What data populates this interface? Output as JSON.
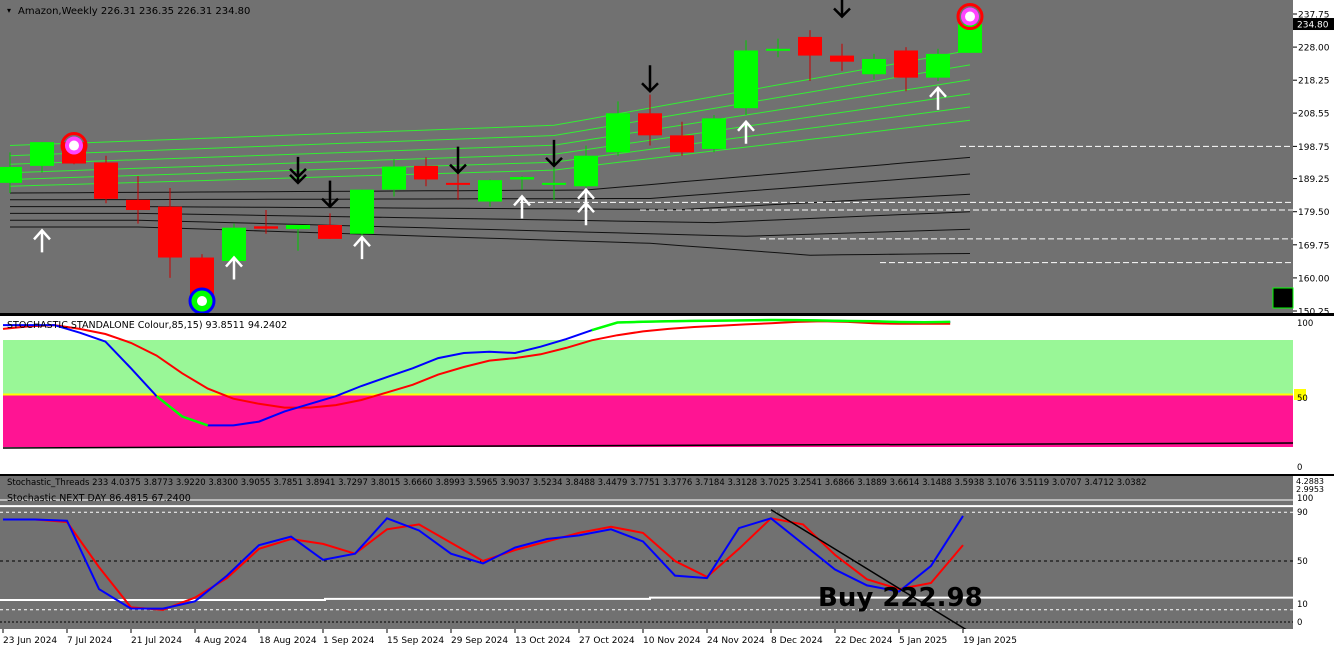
{
  "header": {
    "symbol_line": "Amazon,Weekly  226.31 236.35 226.31 234.80"
  },
  "main_panel": {
    "price_axis": [
      "237.75",
      "228.00",
      "218.25",
      "208.55",
      "198.75",
      "189.25",
      "179.50",
      "169.75",
      "160.00",
      "150.25"
    ],
    "current_price": "234.80",
    "colors": {
      "bull": "#00ff00",
      "bear": "#ff0000",
      "background": "#717171",
      "band_green": "#33ee33",
      "band_black": "#000000"
    }
  },
  "indicator1": {
    "title": "STOCHASTIC STANDALONE Colour,85,15) 93.8511 94.2402",
    "axis": [
      "100",
      "50",
      "0"
    ],
    "zone_colors": {
      "top": "#99f797",
      "bottom": "#ff1493",
      "fifty_marker": "#ffff00"
    }
  },
  "indicator2": {
    "threads_line": "Stochastic_Threads 233 4.0375 3.8773 3.9220 3.8300 3.9055 3.7851 3.8941 3.7297 3.8015 3.6660 3.8993 3.5965 3.9037 3.5234 3.8488 3.4479 3.7751 3.3776 3.7184 3.3128 3.7025 3.2541 3.6866 3.1889 3.6614 3.1488 3.5938 3.1076 3.5119 3.0707 3.4712 3.0382",
    "title": "Stochastic NEXT DAY 86.4815 67.2400",
    "axis_left_top": "4.2883",
    "axis_left_bottom": "2.9953",
    "axis": [
      "100",
      "90",
      "50",
      "10",
      "0"
    ],
    "signal_text": "Buy 222.98"
  },
  "x_axis": {
    "labels": [
      "23 Jun 2024",
      "7 Jul 2024",
      "21 Jul 2024",
      "4 Aug 2024",
      "18 Aug 2024",
      "1 Sep 2024",
      "15 Sep 2024",
      "29 Sep 2024",
      "13 Oct 2024",
      "27 Oct 2024",
      "10 Nov 2024",
      "24 Nov 2024",
      "8 Dec 2024",
      "22 Dec 2024",
      "5 Jan 2025",
      "19 Jan 2025"
    ]
  },
  "chart_data": {
    "type": "candlestick",
    "symbol": "Amazon",
    "timeframe": "Weekly",
    "ohlc": [
      {
        "o": 188.0,
        "h": 197.0,
        "l": 185.0,
        "c": 192.7
      },
      {
        "o": 193.0,
        "h": 200.0,
        "l": 191.0,
        "c": 200.0
      },
      {
        "o": 200.0,
        "h": 201.0,
        "l": 193.5,
        "c": 193.7
      },
      {
        "o": 194.0,
        "h": 196.0,
        "l": 182.0,
        "c": 183.3
      },
      {
        "o": 183.0,
        "h": 190.0,
        "l": 176.0,
        "c": 180.0
      },
      {
        "o": 181.0,
        "h": 186.5,
        "l": 160.0,
        "c": 166.0
      },
      {
        "o": 166.0,
        "h": 167.0,
        "l": 151.6,
        "c": 152.0
      },
      {
        "o": 165.0,
        "h": 176.0,
        "l": 160.0,
        "c": 174.8
      },
      {
        "o": 175.2,
        "h": 180.0,
        "l": 173.0,
        "c": 174.5
      },
      {
        "o": 174.4,
        "h": 175.5,
        "l": 168.0,
        "c": 175.6
      },
      {
        "o": 175.6,
        "h": 179.0,
        "l": 171.5,
        "c": 171.5
      },
      {
        "o": 173.0,
        "h": 186.0,
        "l": 171.0,
        "c": 186.0
      },
      {
        "o": 186.0,
        "h": 195.0,
        "l": 184.0,
        "c": 192.8
      },
      {
        "o": 193.0,
        "h": 195.5,
        "l": 187.0,
        "c": 189.0
      },
      {
        "o": 188.0,
        "h": 192.0,
        "l": 183.0,
        "c": 187.5
      },
      {
        "o": 182.5,
        "h": 189.0,
        "l": 181.0,
        "c": 188.8
      },
      {
        "o": 189.0,
        "h": 190.0,
        "l": 186.0,
        "c": 189.7
      },
      {
        "o": 187.5,
        "h": 195.0,
        "l": 183.0,
        "c": 188.0
      },
      {
        "o": 187.0,
        "h": 199.0,
        "l": 185.0,
        "c": 196.0
      },
      {
        "o": 197.0,
        "h": 212.0,
        "l": 196.0,
        "c": 208.5
      },
      {
        "o": 208.5,
        "h": 214.0,
        "l": 199.0,
        "c": 202.0
      },
      {
        "o": 202.0,
        "h": 206.0,
        "l": 196.0,
        "c": 197.0
      },
      {
        "o": 198.0,
        "h": 208.0,
        "l": 197.0,
        "c": 207.0
      },
      {
        "o": 210.0,
        "h": 230.0,
        "l": 208.0,
        "c": 227.0
      },
      {
        "o": 227.0,
        "h": 230.5,
        "l": 225.0,
        "c": 227.5
      },
      {
        "o": 231.0,
        "h": 233.0,
        "l": 218.0,
        "c": 225.5
      },
      {
        "o": 225.5,
        "h": 229.0,
        "l": 221.0,
        "c": 223.7
      },
      {
        "o": 220.0,
        "h": 226.0,
        "l": 218.5,
        "c": 224.5
      },
      {
        "o": 227.0,
        "h": 228.0,
        "l": 215.0,
        "c": 219.0
      },
      {
        "o": 219.0,
        "h": 227.5,
        "l": 218.0,
        "c": 226.0
      },
      {
        "o": 226.31,
        "h": 236.35,
        "l": 226.31,
        "c": 234.8
      }
    ],
    "price_range": [
      150.25,
      237.75
    ],
    "stoch_standalone": {
      "main": [
        96,
        96,
        96,
        90,
        83,
        62,
        40,
        24,
        17,
        17,
        20,
        28,
        34,
        40,
        48,
        55,
        62,
        70,
        74,
        75,
        74,
        79,
        85,
        92,
        98,
        98.6,
        99,
        99.3,
        99.5,
        99.7,
        100,
        99.9,
        99.6,
        99.2,
        99,
        98.4,
        98.2,
        98.5
      ],
      "signal": [
        93,
        95,
        96,
        93,
        89,
        82,
        72,
        58,
        46,
        38,
        34,
        31,
        31,
        33,
        37,
        43,
        49,
        57,
        63,
        68,
        70,
        73,
        78,
        84,
        88,
        91,
        93,
        94.5,
        95.5,
        96.5,
        97.5,
        98.5,
        99,
        98.5,
        97.5,
        97,
        97,
        97
      ]
    },
    "stoch_next_day": {
      "blue": [
        84,
        84,
        83,
        27,
        11,
        11,
        17,
        38,
        63,
        70,
        51,
        56,
        85,
        75,
        56,
        48,
        61,
        68,
        71,
        76,
        66,
        38,
        36,
        77,
        85,
        64,
        43,
        30,
        25,
        46,
        87
      ],
      "red": [
        84,
        84,
        82,
        45,
        12,
        10,
        20,
        36,
        60,
        68,
        64,
        56,
        76,
        80,
        65,
        50,
        59,
        66,
        73,
        78,
        73,
        50,
        37,
        60,
        85,
        80,
        55,
        35,
        27,
        32,
        63
      ]
    },
    "support_levels": [
      198.75,
      182.25,
      180.0,
      171.5,
      164.5
    ],
    "buy_signal_price": 222.98
  }
}
